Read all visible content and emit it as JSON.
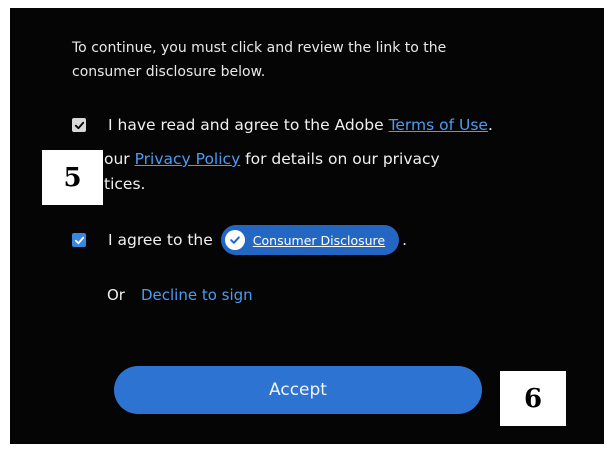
{
  "intro": {
    "line1": "To continue, you must click and review the link to the",
    "line2": "consumer disclosure below."
  },
  "terms_row": {
    "checked": true,
    "prefix": "I have read and agree to the Adobe ",
    "terms_link": "Terms of Use",
    "suffix": "."
  },
  "privacy_row": {
    "prefix": "our ",
    "privacy_link": "Privacy Policy",
    "suffix": " for details on our privacy",
    "line2": "tices."
  },
  "consumer_row": {
    "checked": true,
    "prefix": "I agree to the",
    "disclosure_link": "Consumer Disclosure",
    "suffix": "."
  },
  "decline_row": {
    "or_text": "Or",
    "decline_link": "Decline to sign"
  },
  "accept_button": {
    "label": "Accept"
  },
  "step_labels": {
    "five": "5",
    "six": "6"
  },
  "colors": {
    "background": "#050505",
    "link": "#4d9bf2",
    "accent": "#2c73d2",
    "checkbox_checked": "#3a86de"
  },
  "icons": {
    "checkbox": "checkmark-icon",
    "pill_badge": "check-circle-icon"
  }
}
